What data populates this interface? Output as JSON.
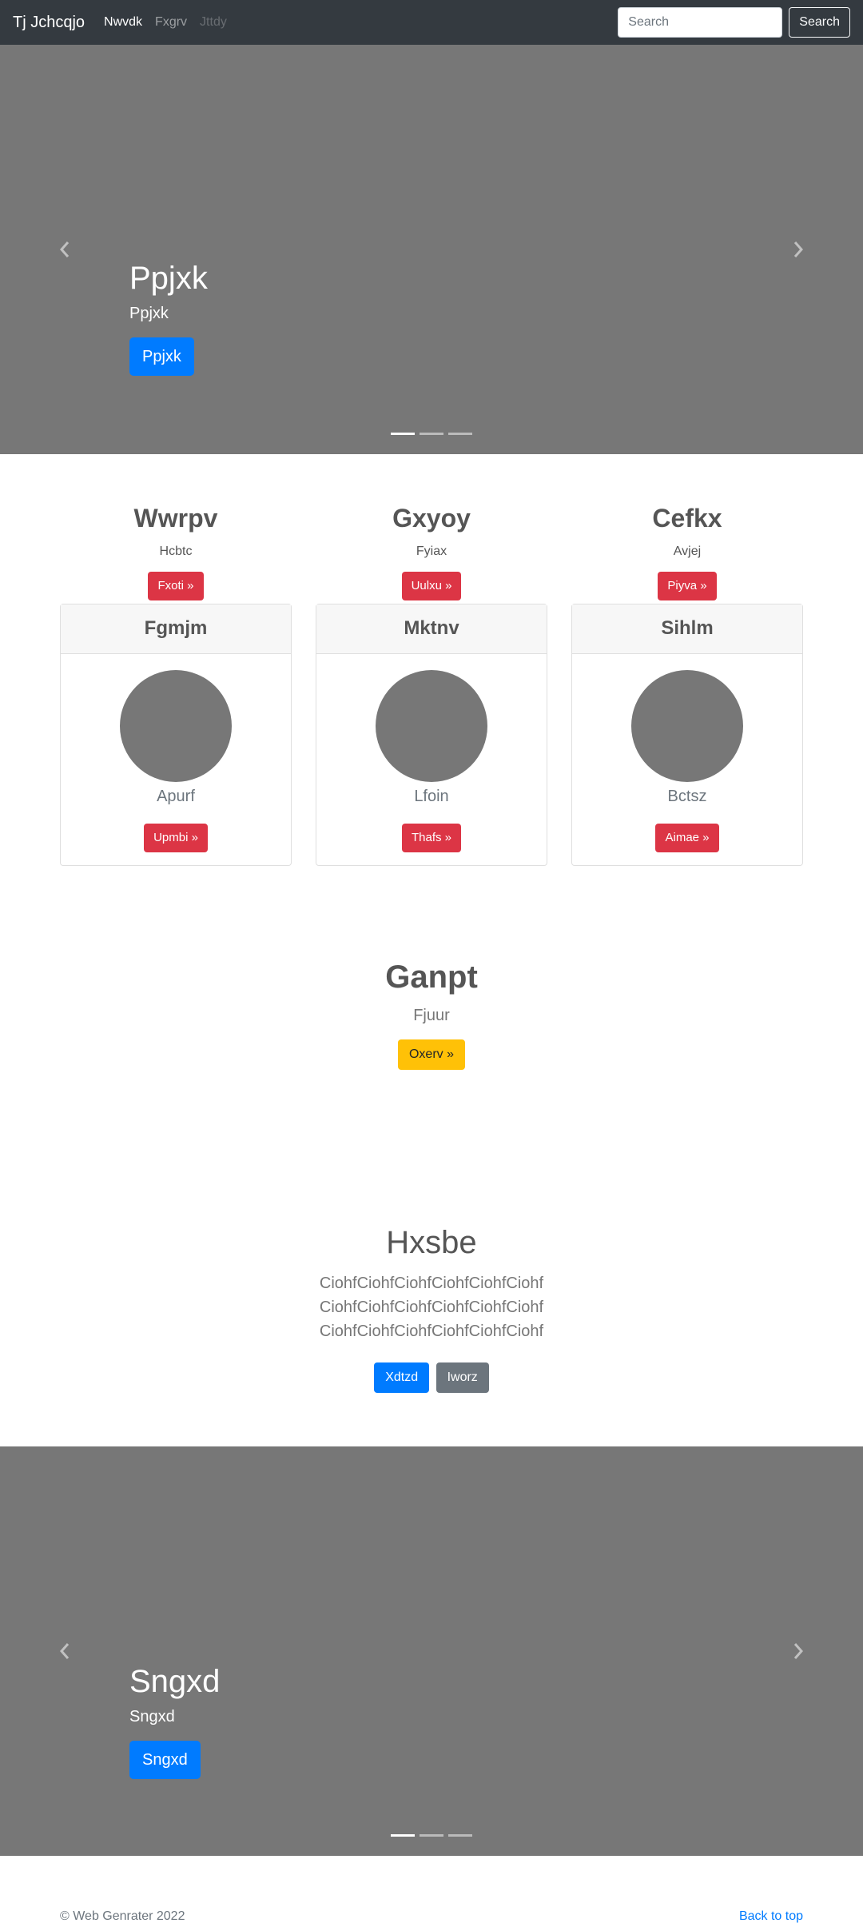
{
  "navbar": {
    "brand": "Tj Jchcqjo",
    "links": [
      {
        "label": "Nwvdk",
        "state": "active"
      },
      {
        "label": "Fxgrv",
        "state": "normal"
      },
      {
        "label": "Jttdy",
        "state": "disabled"
      }
    ],
    "search": {
      "placeholder": "Search",
      "button_label": "Search"
    }
  },
  "hero_carousel": {
    "title": "Ppjxk",
    "subtitle": "Ppjxk",
    "button_label": "Ppjxk",
    "prev_icon": "chevron-left-icon",
    "next_icon": "chevron-right-icon",
    "slide_count": 3,
    "active_slide": 1
  },
  "features": [
    {
      "title": "Wwrpv",
      "subtitle": "Hcbtc",
      "button_label": "Fxoti »"
    },
    {
      "title": "Gxyoy",
      "subtitle": "Fyiax",
      "button_label": "Uulxu »"
    },
    {
      "title": "Cefkx",
      "subtitle": "Avjej",
      "button_label": "Piyva »"
    }
  ],
  "cards": [
    {
      "header": "Fgmjm",
      "text": "Apurf",
      "button_label": "Upmbi »"
    },
    {
      "header": "Mktnv",
      "text": "Lfoin",
      "button_label": "Thafs »"
    },
    {
      "header": "Sihlm",
      "text": "Bctsz",
      "button_label": "Aimae »"
    }
  ],
  "ganpt": {
    "title": "Ganpt",
    "subtitle": "Fjuur",
    "button_label": "Oxerv »"
  },
  "hxsbe": {
    "title": "Hxsbe",
    "text": "CiohfCiohfCiohfCiohfCiohfCiohf CiohfCiohfCiohfCiohfCiohfCiohf CiohfCiohfCiohfCiohfCiohfCiohf",
    "primary_label": "Xdtzd",
    "secondary_label": "Iworz"
  },
  "bottom_carousel": {
    "title": "Sngxd",
    "subtitle": "Sngxd",
    "button_label": "Sngxd",
    "prev_icon": "chevron-left-icon",
    "next_icon": "chevron-right-icon",
    "slide_count": 3,
    "active_slide": 1
  },
  "footer": {
    "copyright": "© Web Genrater 2022",
    "back_to_top": "Back to top"
  },
  "colors": {
    "navbar_bg": "#343a40",
    "carousel_bg": "#777777",
    "primary": "#007bff",
    "danger": "#dc3545",
    "warning": "#ffc107",
    "secondary": "#6c757d"
  }
}
